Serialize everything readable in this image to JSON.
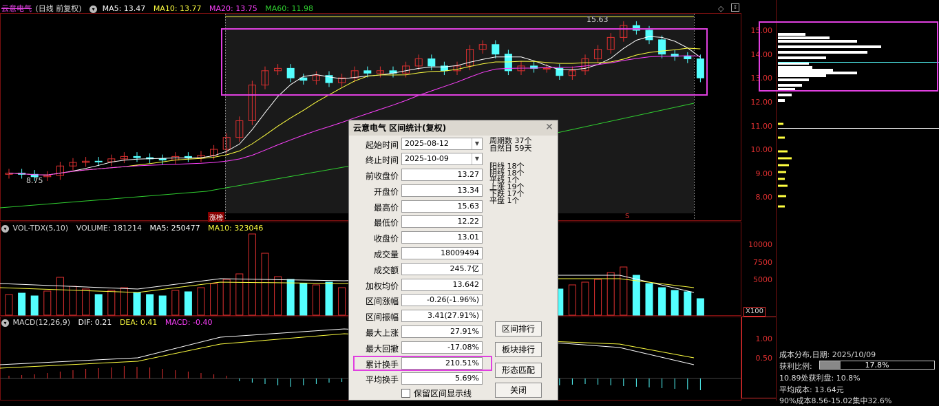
{
  "header": {
    "stock_name": "云意电气",
    "mode": "(日线 前复权)",
    "ma5": "MA5: 13.47",
    "ma10": "MA10: 13.77",
    "ma20": "MA20: 13.75",
    "ma60": "MA60: 11.98",
    "high_mark": "15.63",
    "low_mark": "8.75",
    "zhangbang": "涨榜",
    "s_mark": "S"
  },
  "volume_header": {
    "name": "VOL-TDX(5,10)",
    "volume": "VOLUME: 181214",
    "ma5": "MA5: 250477",
    "ma10": "MA10: 323046",
    "unit": "X100"
  },
  "macd_header": {
    "name": "MACD(12,26,9)",
    "dif": "DIF: 0.21",
    "dea": "DEA: 0.41",
    "macd": "MACD: -0.40"
  },
  "price_axis": [
    "15.00",
    "14.00",
    "13.00",
    "12.00",
    "11.00",
    "10.00",
    "9.00",
    "8.00"
  ],
  "volume_axis": [
    "10000",
    "7500",
    "5000"
  ],
  "macd_axis": [
    "1.00",
    "0.50"
  ],
  "dialog": {
    "title": "云意电气 区间统计(复权)",
    "start_label": "起始时间",
    "start_value": "2025-08-12",
    "end_label": "终止时间",
    "end_value": "2025-10-09",
    "rows": [
      {
        "label": "前收盘价",
        "value": "13.27"
      },
      {
        "label": "开盘价",
        "value": "13.34"
      },
      {
        "label": "最高价",
        "value": "15.63"
      },
      {
        "label": "最低价",
        "value": "12.22"
      },
      {
        "label": "收盘价",
        "value": "13.01"
      },
      {
        "label": "成交量",
        "value": "18009494"
      },
      {
        "label": "成交额",
        "value": "245.7亿"
      },
      {
        "label": "加权均价",
        "value": "13.642"
      },
      {
        "label": "区间涨幅",
        "value": "-0.26(-1.96%)"
      },
      {
        "label": "区间振幅",
        "value": "3.41(27.91%)"
      },
      {
        "label": "最大上涨",
        "value": "27.91%"
      },
      {
        "label": "最大回撤",
        "value": "-17.08%"
      },
      {
        "label": "累计换手",
        "value": "210.51%"
      },
      {
        "label": "平均换手",
        "value": "5.69%"
      }
    ],
    "stats": [
      "周期数 37个",
      "自然日 59天",
      "阳线 18个",
      "阴线 18个",
      "平线 1个",
      "上涨 19个",
      "下跌 17个",
      "平盘 1个"
    ],
    "buttons": [
      "区间排行",
      "板块排行",
      "形态匹配",
      "关闭"
    ],
    "checkbox_label": "保留区间显示线"
  },
  "side": {
    "title": "成本分布,日期: 2025/10/09",
    "profit_label": "获利比例:",
    "profit_value": "17.8%",
    "profit_ratio": 0.178,
    "profit_line": "10.89处获利盘: 10.8%",
    "avg_cost": "平均成本: 13.64元",
    "concentration": "90%成本8.56-15.02集中32.6%"
  },
  "colors": {
    "up": "#e03030",
    "down": "#54ffff",
    "ma5": "#ffffff",
    "ma10": "#ffff40",
    "ma20": "#ff40ff",
    "ma60": "#30d030",
    "highlight": "#e040e0"
  }
}
